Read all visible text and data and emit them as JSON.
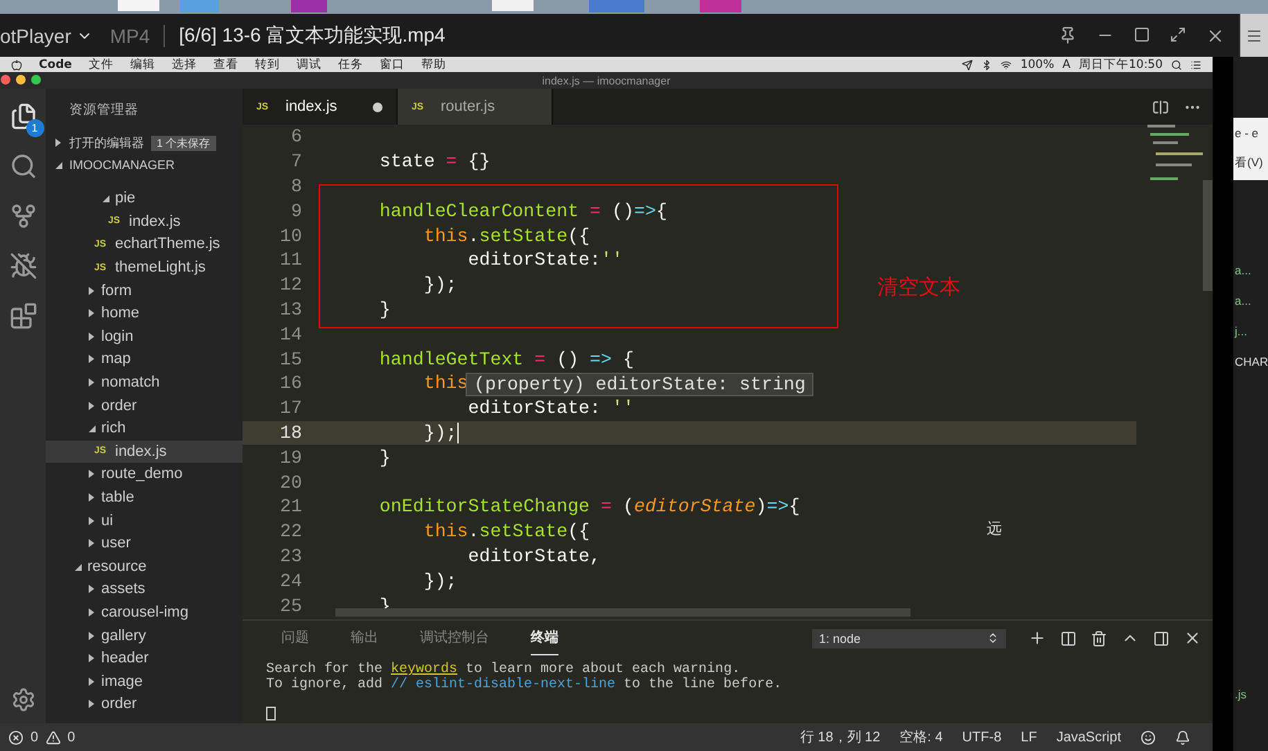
{
  "player": {
    "app_name": "otPlayer",
    "format": "MP4",
    "title": "[6/6] 13-6 富文本功能实现.mp4"
  },
  "menubar": {
    "app": "Code",
    "items": [
      "文件",
      "编辑",
      "选择",
      "查看",
      "转到",
      "调试",
      "任务",
      "窗口",
      "帮助"
    ],
    "battery": "100%",
    "input": "A",
    "clock": "周日下午10:50"
  },
  "window": {
    "title": "index.js — imoocmanager"
  },
  "activity": {
    "badge": "1"
  },
  "explorer": {
    "title": "资源管理器",
    "open_editors": "打开的编辑器",
    "unsaved": "1 个未保存",
    "project": "IMOOCMANAGER",
    "tree": [
      {
        "children": [
          {
            "children": [
              {
                "label": "pie",
                "kind": "folder",
                "expanded": true,
                "selected": false,
                "children": [
                  {
                    "label": "index.js",
                    "kind": "file",
                    "icon": "JS",
                    "selected": false
                  }
                ]
              },
              {
                "label": "echartTheme.js",
                "kind": "file",
                "icon": "JS",
                "selected": false
              },
              {
                "label": "themeLight.js",
                "kind": "file",
                "icon": "JS",
                "selected": false
              }
            ]
          },
          {
            "label": "form",
            "kind": "folder",
            "expanded": false,
            "selected": false
          },
          {
            "label": "home",
            "kind": "folder",
            "expanded": false,
            "selected": false
          },
          {
            "label": "login",
            "kind": "folder",
            "expanded": false,
            "selected": false
          },
          {
            "label": "map",
            "kind": "folder",
            "expanded": false,
            "selected": false
          },
          {
            "label": "nomatch",
            "kind": "folder",
            "expanded": false,
            "selected": false
          },
          {
            "label": "order",
            "kind": "folder",
            "expanded": false,
            "selected": false
          },
          {
            "label": "rich",
            "kind": "folder",
            "expanded": true,
            "selected": false,
            "children": [
              {
                "label": "index.js",
                "kind": "file",
                "icon": "JS",
                "selected": true
              }
            ]
          },
          {
            "label": "route_demo",
            "kind": "folder",
            "expanded": false,
            "selected": false
          },
          {
            "label": "table",
            "kind": "folder",
            "expanded": false,
            "selected": false
          },
          {
            "label": "ui",
            "kind": "folder",
            "expanded": false,
            "selected": false
          },
          {
            "label": "user",
            "kind": "folder",
            "expanded": false,
            "selected": false
          }
        ]
      },
      {
        "label": "resource",
        "kind": "folder",
        "expanded": true,
        "selected": false,
        "children": [
          {
            "label": "assets",
            "kind": "folder",
            "expanded": false,
            "selected": false
          },
          {
            "label": "carousel-img",
            "kind": "folder",
            "expanded": false,
            "selected": false
          },
          {
            "label": "gallery",
            "kind": "folder",
            "expanded": false,
            "selected": false
          },
          {
            "label": "header",
            "kind": "folder",
            "expanded": false,
            "selected": false
          },
          {
            "label": "image",
            "kind": "folder",
            "expanded": false,
            "selected": false
          },
          {
            "label": "order",
            "kind": "folder",
            "expanded": false,
            "selected": false
          }
        ]
      }
    ]
  },
  "tabs": [
    {
      "icon": "JS",
      "label": "index.js",
      "selected": true,
      "modified": true
    },
    {
      "icon": "JS",
      "label": "router.js",
      "selected": false,
      "modified": false
    }
  ],
  "code": [
    {
      "number": "6",
      "current": false
    },
    {
      "number": "7",
      "current": false,
      "tokens": [
        {
          "kind": "plain",
          "text": "    state "
        },
        {
          "kind": "op",
          "text": "="
        },
        {
          "kind": "plain",
          "text": " {}"
        }
      ]
    },
    {
      "number": "8",
      "current": false
    },
    {
      "number": "9",
      "current": false,
      "tokens": [
        {
          "kind": "fn",
          "text": "    handleClearContent"
        },
        {
          "kind": "op",
          "text": " ="
        },
        {
          "kind": "plain",
          "text": " ()"
        },
        {
          "kind": "arrow",
          "text": "=>"
        },
        {
          "kind": "plain",
          "text": "{"
        }
      ]
    },
    {
      "number": "10",
      "current": false,
      "tokens": [
        {
          "kind": "keyword",
          "text": "        this"
        },
        {
          "kind": "plain",
          "text": "."
        },
        {
          "kind": "fn",
          "text": "setState"
        },
        {
          "kind": "plain",
          "text": "({"
        }
      ]
    },
    {
      "number": "11",
      "current": false,
      "tokens": [
        {
          "kind": "plain",
          "text": "            editorState:"
        },
        {
          "kind": "string",
          "text": "''"
        }
      ]
    },
    {
      "number": "12",
      "current": false,
      "tokens": [
        {
          "kind": "plain",
          "text": "        });"
        }
      ]
    },
    {
      "number": "13",
      "current": false,
      "tokens": [
        {
          "kind": "plain",
          "text": "    }"
        }
      ]
    },
    {
      "number": "14",
      "current": false
    },
    {
      "number": "15",
      "current": false,
      "tokens": [
        {
          "kind": "fn",
          "text": "    handleGetText"
        },
        {
          "kind": "op",
          "text": " ="
        },
        {
          "kind": "plain",
          "text": " () "
        },
        {
          "kind": "arrow",
          "text": "=>"
        },
        {
          "kind": "plain",
          "text": " {"
        }
      ]
    },
    {
      "number": "16",
      "current": false,
      "tokens": [
        {
          "kind": "keyword",
          "text": "        this"
        }
      ]
    },
    {
      "number": "17",
      "current": false,
      "tokens": [
        {
          "kind": "plain",
          "text": "            editorState: "
        },
        {
          "kind": "string",
          "text": "''"
        }
      ]
    },
    {
      "number": "18",
      "current": true,
      "tokens": [
        {
          "kind": "plain",
          "text": "        });"
        }
      ]
    },
    {
      "number": "19",
      "current": false,
      "tokens": [
        {
          "kind": "plain",
          "text": "    }"
        }
      ]
    },
    {
      "number": "20",
      "current": false
    },
    {
      "number": "21",
      "current": false,
      "tokens": [
        {
          "kind": "fn",
          "text": "    onEditorStateChange"
        },
        {
          "kind": "op",
          "text": " ="
        },
        {
          "kind": "plain",
          "text": " ("
        },
        {
          "kind": "param",
          "text": "editorState"
        },
        {
          "kind": "plain",
          "text": ")"
        },
        {
          "kind": "arrow",
          "text": "=>"
        },
        {
          "kind": "plain",
          "text": "{"
        }
      ]
    },
    {
      "number": "22",
      "current": false,
      "tokens": [
        {
          "kind": "keyword",
          "text": "        this"
        },
        {
          "kind": "plain",
          "text": "."
        },
        {
          "kind": "fn",
          "text": "setState"
        },
        {
          "kind": "plain",
          "text": "({"
        }
      ]
    },
    {
      "number": "23",
      "current": false,
      "tokens": [
        {
          "kind": "plain",
          "text": "            editorState,"
        }
      ]
    },
    {
      "number": "24",
      "current": false,
      "tokens": [
        {
          "kind": "plain",
          "text": "        });"
        }
      ]
    },
    {
      "number": "25",
      "current": false,
      "tokens": [
        {
          "kind": "plain",
          "text": "    }"
        }
      ]
    }
  ],
  "tooltip": "(property) editorState: string",
  "annotations": [
    {
      "kind": "box",
      "text": "清空文本"
    },
    {
      "kind": "note",
      "text": "远"
    }
  ],
  "panel": {
    "tabs": [
      {
        "label": "问题",
        "selected": false
      },
      {
        "label": "输出",
        "selected": false
      },
      {
        "label": "调试控制台",
        "selected": false
      },
      {
        "label": "终端",
        "selected": true
      }
    ],
    "terminal_select": "1: node",
    "lines": [
      [
        {
          "kind": "plain",
          "text": "Search for the "
        },
        {
          "kind": "link",
          "text": "keywords"
        },
        {
          "kind": "plain",
          "text": " to learn more about each warning."
        }
      ],
      [
        {
          "kind": "plain",
          "text": "To ignore, add "
        },
        {
          "kind": "comment",
          "text": "// eslint-disable-next-line"
        },
        {
          "kind": "plain",
          "text": " to the line before."
        }
      ]
    ]
  },
  "status_bar": {
    "errors": "0",
    "warnings": "0",
    "items": [
      "行 18，列 12",
      "空格: 4",
      "UTF-8",
      "LF",
      "JavaScript"
    ]
  },
  "behind_window": {
    "top": [
      "e - e",
      "看(V)"
    ],
    "items": [
      "a...",
      "a...",
      "j...",
      "CHAR"
    ],
    "bottom": ".js"
  }
}
